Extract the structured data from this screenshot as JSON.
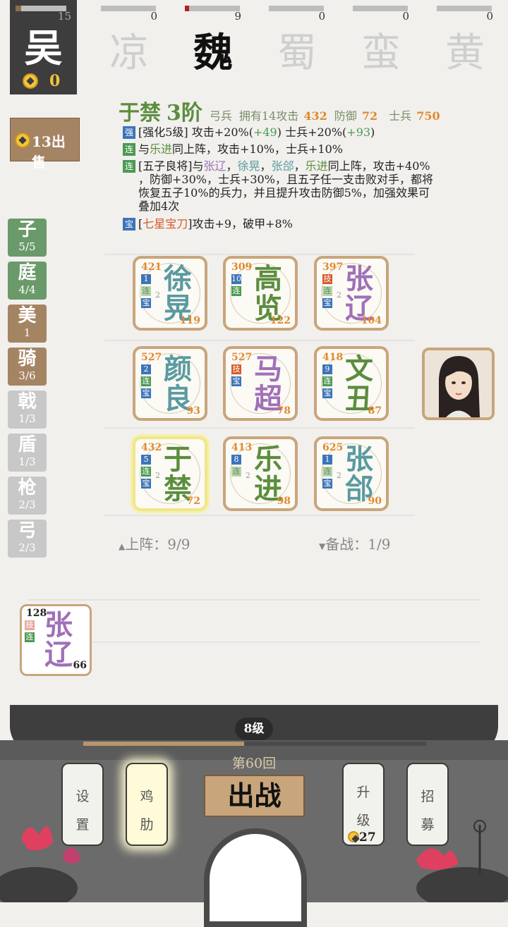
{
  "factions": {
    "selected": {
      "name": "吴",
      "count": "15",
      "coins": "0"
    },
    "list": [
      {
        "name": "凉",
        "count": "0"
      },
      {
        "name": "魏",
        "count": "9"
      },
      {
        "name": "蜀",
        "count": "0"
      },
      {
        "name": "蛮",
        "count": "0"
      },
      {
        "name": "黄",
        "count": "0"
      }
    ]
  },
  "sell": {
    "label": "13出售"
  },
  "hero": {
    "name": "于禁",
    "rank": "3阶",
    "type": "弓兵",
    "owned": "拥有14",
    "atk_label": "攻击",
    "atk": "432",
    "def_label": "防御",
    "def": "72",
    "troops_label": "士兵",
    "troops": "750",
    "lines": {
      "l1a": "[强化5级] 攻击+20%(",
      "l1b": "+49",
      "l1c": ") 士兵+20%(",
      "l1d": "+93",
      "l1e": ")",
      "l2a": "与",
      "l2b": "乐进",
      "l2c": "同上阵，攻击+10%，士兵+10%",
      "l3a": "[五子良将]与",
      "l3b": "张辽",
      "l3c": "，",
      "l3d": "徐晃",
      "l3e": "，",
      "l3f": "张郃",
      "l3g": "，",
      "l3h": "乐进",
      "l3i": "同上阵，攻击+40%",
      "l3j": "，防御+30%，士兵+30%，且五子任一支击败对手，都将",
      "l3k": "恢复五子10%的兵力，并且提升攻击防御5%，加强效果可",
      "l3l": "叠加4次",
      "l4a": "[",
      "l4b": "七星宝刀",
      "l4c": "]攻击+9，破甲+8%"
    },
    "tags": {
      "qiang": "强",
      "lian": "连",
      "bao": "宝"
    }
  },
  "tiers": [
    {
      "name": "子",
      "count": "5/5"
    },
    {
      "name": "庭",
      "count": "4/4"
    },
    {
      "name": "美",
      "count": "1"
    },
    {
      "name": "骑",
      "count": "3/6"
    },
    {
      "name": "戟",
      "count": "1/3"
    },
    {
      "name": "盾",
      "count": "1/3"
    },
    {
      "name": "枪",
      "count": "2/3"
    },
    {
      "name": "弓",
      "count": "2/3"
    }
  ],
  "board": [
    {
      "name1": "徐",
      "name2": "晃",
      "atk": "421",
      "def": "119",
      "b1": "1",
      "b2": "连",
      "b3": "宝",
      "b2n": "2"
    },
    {
      "name1": "高",
      "name2": "览",
      "atk": "309",
      "def": "122",
      "b1": "10",
      "b2": "连"
    },
    {
      "name1": "张",
      "name2": "辽",
      "atk": "397",
      "def": "104",
      "b1": "技",
      "b2": "连",
      "b3": "宝",
      "b2n": "2"
    },
    {
      "name1": "颜",
      "name2": "良",
      "atk": "527",
      "def": "93",
      "b1": "2",
      "b2": "连",
      "b3": "宝"
    },
    {
      "name1": "马",
      "name2": "超",
      "atk": "527",
      "def": "78",
      "b1": "技",
      "b2": "宝"
    },
    {
      "name1": "文",
      "name2": "丑",
      "atk": "418",
      "def": "87",
      "b1": "9",
      "b2": "连",
      "b3": "宝"
    },
    {
      "name1": "于",
      "name2": "禁",
      "atk": "432",
      "def": "72",
      "b1": "5",
      "b2": "连",
      "b3": "宝",
      "b2n": "2"
    },
    {
      "name1": "乐",
      "name2": "进",
      "atk": "413",
      "def": "98",
      "b1": "8",
      "b2": "连",
      "b2n": "2"
    },
    {
      "name1": "张",
      "name2": "郃",
      "atk": "625",
      "def": "90",
      "b1": "1",
      "b2": "连",
      "b3": "宝",
      "b2n": "2"
    }
  ],
  "counts": {
    "on": "上阵：9/9",
    "bench": "备战：1/9"
  },
  "bench": {
    "name1": "张",
    "name2": "辽",
    "atk": "128",
    "def": "66",
    "b1": "技",
    "b2": "连"
  },
  "footer": {
    "level": "8级",
    "level_progress": 0.47,
    "round": "第60回",
    "settings": "设置",
    "chicken": "鸡肋",
    "fight": "出战",
    "upgrade": "升级",
    "upgrade_cost": "27",
    "recruit": "招募"
  },
  "colors": {
    "green": "#5c8d3e",
    "purple": "#a070b8",
    "teal": "#5a9aa0",
    "gold": "#e08a2e"
  }
}
